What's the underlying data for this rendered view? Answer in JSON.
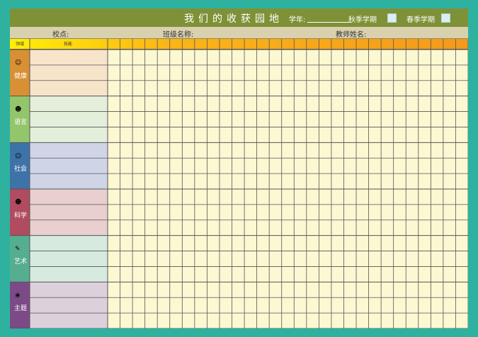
{
  "header": {
    "title": "我们的收获园地",
    "year_label": "学年:",
    "autumn_label": "秋季学期",
    "spring_label": "春季学期"
  },
  "info": {
    "school_label": "校点:",
    "class_label": "班级名称:",
    "teacher_label": "教师姓名:"
  },
  "table_head": {
    "domain_label": "领域",
    "skill_label": "技能"
  },
  "domains": [
    {
      "label": "健康",
      "icon": "children-icon",
      "color": "#d99034",
      "band": "#f8e4cb"
    },
    {
      "label": "语言",
      "icon": "reading-children-icon",
      "color": "#93c56a",
      "band": "#e3efdb"
    },
    {
      "label": "社会",
      "icon": "group-children-icon",
      "color": "#3d73a8",
      "band": "#cfd5e6"
    },
    {
      "label": "科学",
      "icon": "explorer-children-icon",
      "color": "#b04b60",
      "band": "#e9cfcf"
    },
    {
      "label": "艺术",
      "icon": "artist-child-icon",
      "color": "#55ae8f",
      "band": "#d7eadf"
    },
    {
      "label": "主题",
      "icon": "theme-children-icon",
      "color": "#7b4a87",
      "band": "#dcd0dc"
    }
  ]
}
